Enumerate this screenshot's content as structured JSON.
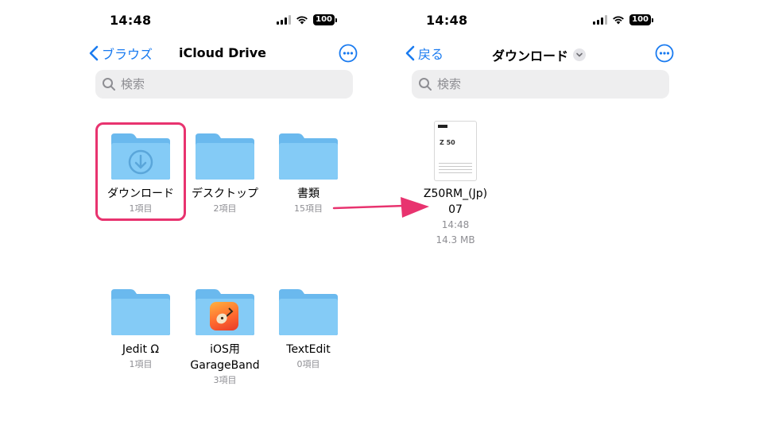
{
  "left_screen": {
    "status": {
      "time": "14:48",
      "battery": "100"
    },
    "nav": {
      "back_label": "ブラウズ",
      "title": "iCloud Drive"
    },
    "search": {
      "placeholder": "検索"
    },
    "folders": [
      {
        "name": "ダウンロード",
        "sub": "1項目",
        "icon": "download-folder-icon",
        "highlighted": true
      },
      {
        "name": "デスクトップ",
        "sub": "2項目",
        "icon": "folder-icon"
      },
      {
        "name": "書類",
        "sub": "15項目",
        "icon": "folder-icon"
      },
      {
        "name": "Jedit Ω",
        "sub": "1項目",
        "icon": "folder-icon"
      },
      {
        "name": "iOS用",
        "name2": "GarageBand",
        "sub": "3項目",
        "icon": "garageband-folder-icon"
      },
      {
        "name": "TextEdit",
        "sub": "0項目",
        "icon": "folder-icon"
      }
    ]
  },
  "right_screen": {
    "status": {
      "time": "14:48",
      "battery": "100"
    },
    "nav": {
      "back_label": "戻る",
      "title": "ダウンロード"
    },
    "search": {
      "placeholder": "検索"
    },
    "file": {
      "name_line1": "Z50RM_(Jp)",
      "name_line2": "07",
      "time": "14:48",
      "size": "14.3 MB",
      "icon": "pdf-document-thumbnail"
    }
  },
  "colors": {
    "accent": "#1a7bf0",
    "folder": "#7fc7f5",
    "highlight": "#e8336f"
  }
}
